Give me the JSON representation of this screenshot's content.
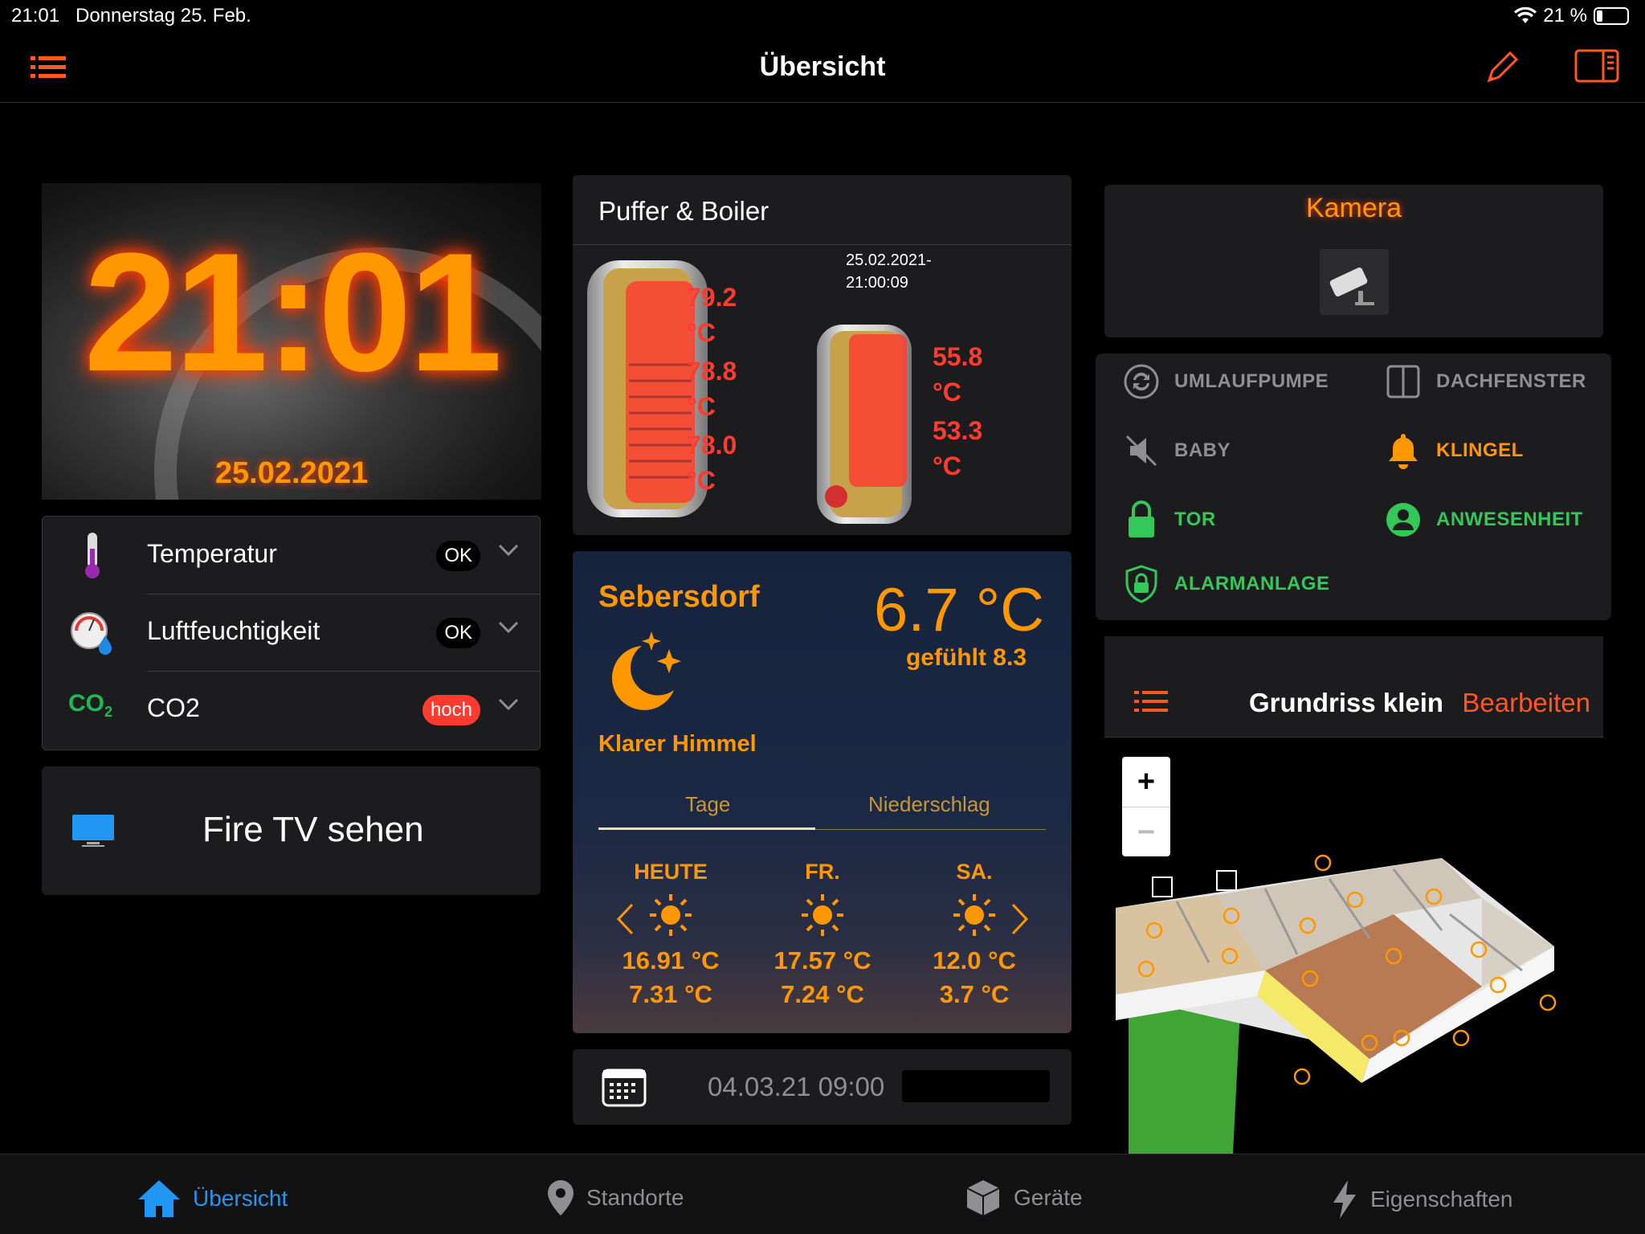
{
  "status_bar": {
    "time": "21:01",
    "date": "Donnerstag 25. Feb.",
    "battery": "21 %"
  },
  "nav": {
    "title": "Übersicht"
  },
  "clock": {
    "time": "21:01",
    "date": "25.02.2021"
  },
  "sensors": [
    {
      "label": "Temperatur",
      "badge": "OK",
      "badge_color": "#000000"
    },
    {
      "label": "Luftfeuchtigkeit",
      "badge": "OK",
      "badge_color": "#000000"
    },
    {
      "label": "CO2",
      "badge": "hoch",
      "badge_color": "#ff3b30",
      "icon_text": "CO",
      "icon_sub": "2"
    }
  ],
  "firetv": {
    "label": "Fire TV sehen"
  },
  "puffer": {
    "title": "Puffer & Boiler",
    "timestamp_line1": "25.02.2021-",
    "timestamp_line2": "21:00:09",
    "tank1": [
      {
        "value": "79.2",
        "unit": "°C"
      },
      {
        "value": "78.8",
        "unit": "°C"
      },
      {
        "value": "78.0",
        "unit": "°C"
      }
    ],
    "tank2": [
      {
        "value": "55.8",
        "unit": "°C"
      },
      {
        "value": "53.3",
        "unit": "°C"
      }
    ]
  },
  "weather": {
    "city": "Sebersdorf",
    "temp": "6.7 °C",
    "feels": "gefühlt 8.3",
    "condition": "Klarer Himmel",
    "tabs": [
      "Tage",
      "Niederschlag"
    ],
    "days": [
      {
        "name": "HEUTE",
        "hi": "16.91 °C",
        "lo": "7.31 °C"
      },
      {
        "name": "FR.",
        "hi": "17.57 °C",
        "lo": "7.24 °C"
      },
      {
        "name": "SA.",
        "hi": "12.0 °C",
        "lo": "3.7 °C"
      }
    ]
  },
  "calendar": {
    "text": "04.03.21 09:00"
  },
  "camera": {
    "title": "Kamera"
  },
  "states": [
    {
      "label": "UMLAUFPUMPE",
      "color": "#8e8e93",
      "icon": "sync-icon"
    },
    {
      "label": "DACHFENSTER",
      "color": "#8e8e93",
      "icon": "window-icon"
    },
    {
      "label": "BABY",
      "color": "#8e8e93",
      "icon": "mute-icon"
    },
    {
      "label": "KLINGEL",
      "color": "#ff9800",
      "icon": "bell-icon"
    },
    {
      "label": "TOR",
      "color": "#34c759",
      "icon": "lock-icon"
    },
    {
      "label": "ANWESENHEIT",
      "color": "#34c759",
      "icon": "person-icon"
    },
    {
      "label": "ALARMANLAGE",
      "color": "#34c759",
      "icon": "shield-icon"
    }
  ],
  "grundriss": {
    "title": "Grundriss klein",
    "edit": "Bearbeiten",
    "zoom_in": "+",
    "zoom_out": "−"
  },
  "tabbar": [
    {
      "label": "Übersicht",
      "active": true
    },
    {
      "label": "Standorte",
      "active": false
    },
    {
      "label": "Geräte",
      "active": false
    },
    {
      "label": "Eigenschaften",
      "active": false
    }
  ],
  "colors": {
    "accent": "#ff5722",
    "orange": "#ff9800",
    "green": "#34c759",
    "red": "#ff3b30",
    "blue": "#2196f3"
  }
}
